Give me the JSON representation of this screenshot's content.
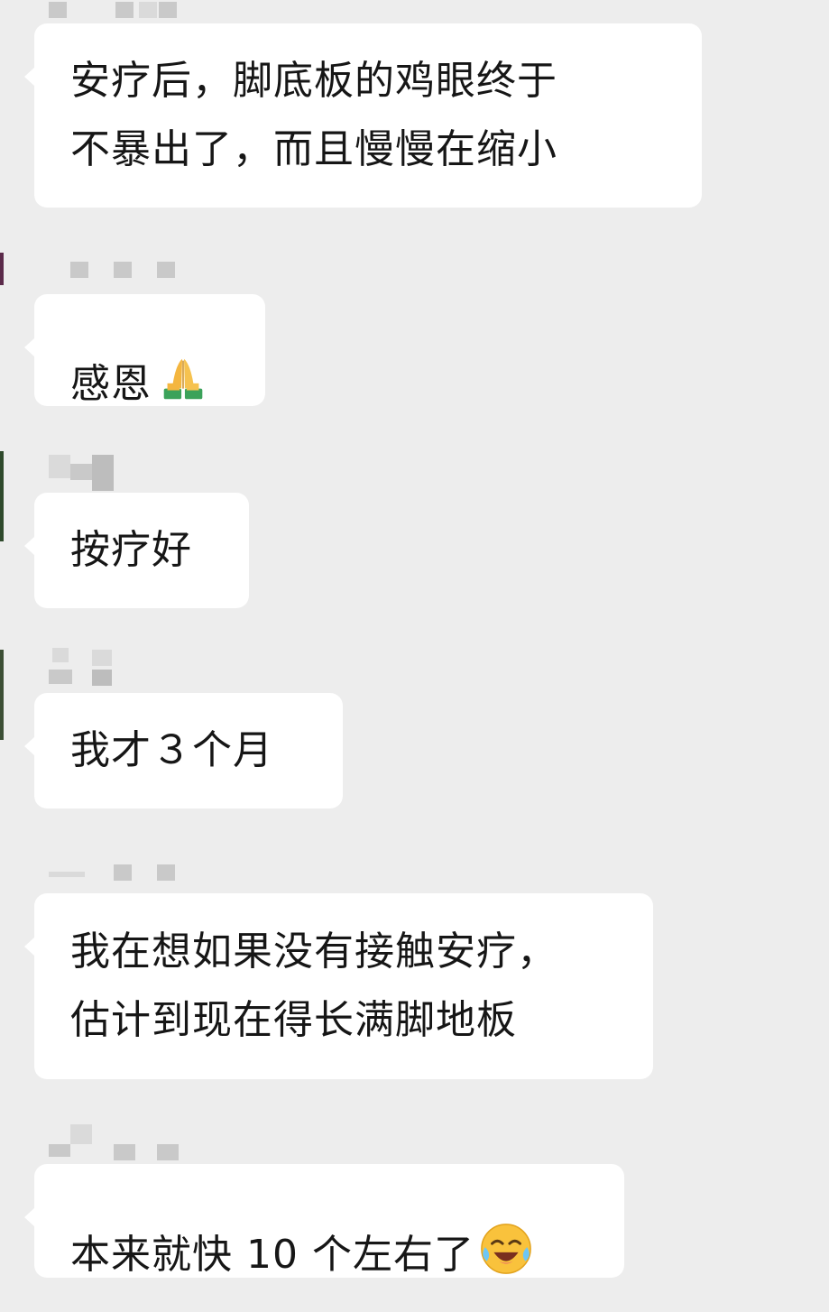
{
  "chat": {
    "messages": [
      {
        "text": "安疗后，脚底板的鸡眼终于\n不暴出了，而且慢慢在缩小"
      },
      {
        "text": "感恩",
        "emoji": "folded-hands-icon"
      },
      {
        "text": "按疗好"
      },
      {
        "text": "我才３个月"
      },
      {
        "text": "我在想如果没有接触安疗，\n估计到现在得长满脚地板"
      },
      {
        "text": "本来就快 10 个左右了",
        "emoji": "crying-laughing-face-icon"
      }
    ]
  },
  "theme": {
    "background": "#ededed",
    "bubble": "#ffffff",
    "text": "#161616",
    "redaction": "#c9c9c9"
  }
}
